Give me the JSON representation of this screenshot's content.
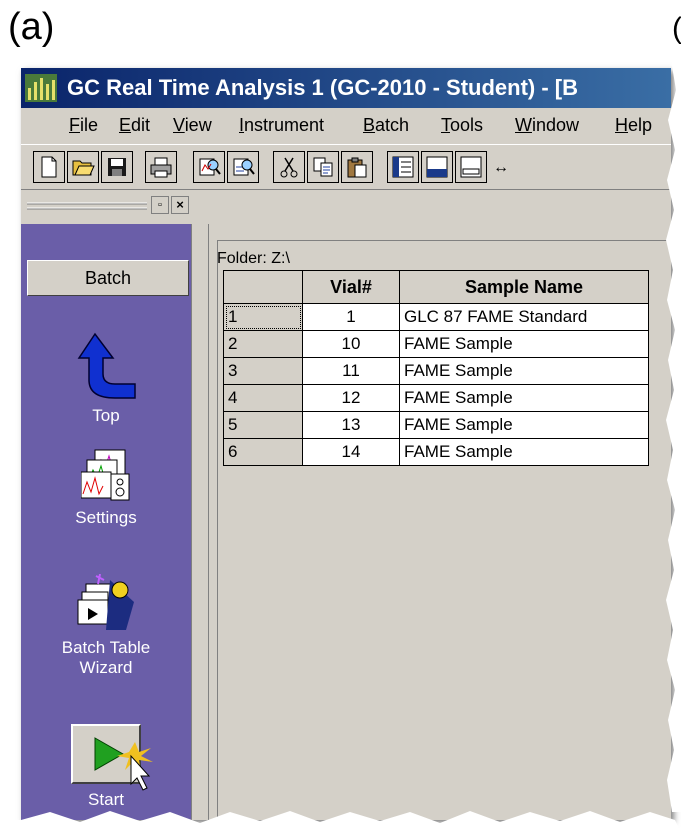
{
  "figure_label": "(a)",
  "stray_label": "(",
  "window": {
    "title": "GC Real Time Analysis 1 (GC-2010 - Student) - [B"
  },
  "menu": [
    {
      "label": "File",
      "ul": "F",
      "rest": "ile"
    },
    {
      "label": "Edit",
      "ul": "E",
      "rest": "dit"
    },
    {
      "label": "View",
      "ul": "V",
      "rest": "iew"
    },
    {
      "label": "Instrument",
      "ul": "I",
      "rest": "nstrument"
    },
    {
      "label": "Batch",
      "ul": "B",
      "rest": "atch"
    },
    {
      "label": "Tools",
      "ul": "T",
      "rest": "ools"
    },
    {
      "label": "Window",
      "ul": "W",
      "rest": "indow"
    },
    {
      "label": "Help",
      "ul": "H",
      "rest": "elp"
    }
  ],
  "toolbar": {
    "buttons": [
      "new-icon",
      "open-icon",
      "save-icon",
      "print-icon",
      "view-data-icon",
      "view-data-2-icon",
      "cut-icon",
      "copy-icon",
      "paste-icon",
      "layout-1-icon",
      "layout-2-icon",
      "layout-3-icon"
    ]
  },
  "sidebar": {
    "header": "Batch",
    "items": [
      {
        "label": "Top",
        "icon": "up-arrow-icon"
      },
      {
        "label": "Settings",
        "icon": "settings-icon"
      },
      {
        "label": "Batch Table",
        "label2": "Wizard",
        "icon": "wizard-icon"
      },
      {
        "label": "Start",
        "icon": "start-icon"
      }
    ]
  },
  "folder": "Folder: Z:\\",
  "table": {
    "headers": [
      "",
      "Vial#",
      "Sample Name"
    ],
    "rows": [
      {
        "row": "1",
        "vial": "1",
        "name": "GLC 87 FAME Standard"
      },
      {
        "row": "2",
        "vial": "10",
        "name": "FAME Sample"
      },
      {
        "row": "3",
        "vial": "11",
        "name": "FAME Sample"
      },
      {
        "row": "4",
        "vial": "12",
        "name": "FAME Sample"
      },
      {
        "row": "5",
        "vial": "13",
        "name": "FAME Sample"
      },
      {
        "row": "6",
        "vial": "14",
        "name": "FAME Sample"
      }
    ]
  },
  "colors": {
    "titlebar": "#0a246a",
    "sidebar": "#6a5ea8",
    "chrome": "#d4d0c8"
  }
}
